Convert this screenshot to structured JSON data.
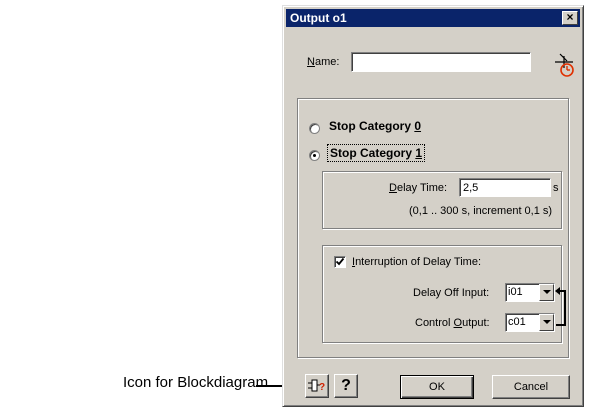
{
  "callout": {
    "label": "Icon for Blockdiagram"
  },
  "dialog": {
    "title": "Output o1",
    "close_glyph": "×",
    "name": {
      "label_prefix": "",
      "label_mnemonic": "N",
      "label_rest": "ame:",
      "value": ""
    },
    "timer_icon": "timer-output-icon",
    "stop_category_0": {
      "label": "Stop Category ",
      "mnemonic": "0",
      "selected": false
    },
    "stop_category_1": {
      "label": "Stop Category ",
      "mnemonic": "1",
      "selected": true
    },
    "delay_time": {
      "label_mnemonic": "D",
      "label_rest": "elay Time:",
      "value": "2,5",
      "unit": "s",
      "hint": "(0,1 .. 300 s, increment 0,1 s)"
    },
    "interruption": {
      "label_mnemonic": "I",
      "label_rest": "nterruption of Delay Time:",
      "checked": true
    },
    "delay_off_input": {
      "label": "Delay Off Input:",
      "value": "i01"
    },
    "control_output": {
      "label_prefix": "Control ",
      "label_mnemonic": "O",
      "label_rest": "utput:",
      "value": "c01"
    },
    "buttons": {
      "blockdiagram_icon": "blockdiagram-icon",
      "help_label": "?",
      "ok_label": "OK",
      "cancel_label": "Cancel"
    },
    "colors": {
      "title_bar": "#0a246a",
      "face": "#d4d0c8",
      "timer_accent": "#e03000",
      "help_accent": "#d02000"
    }
  }
}
